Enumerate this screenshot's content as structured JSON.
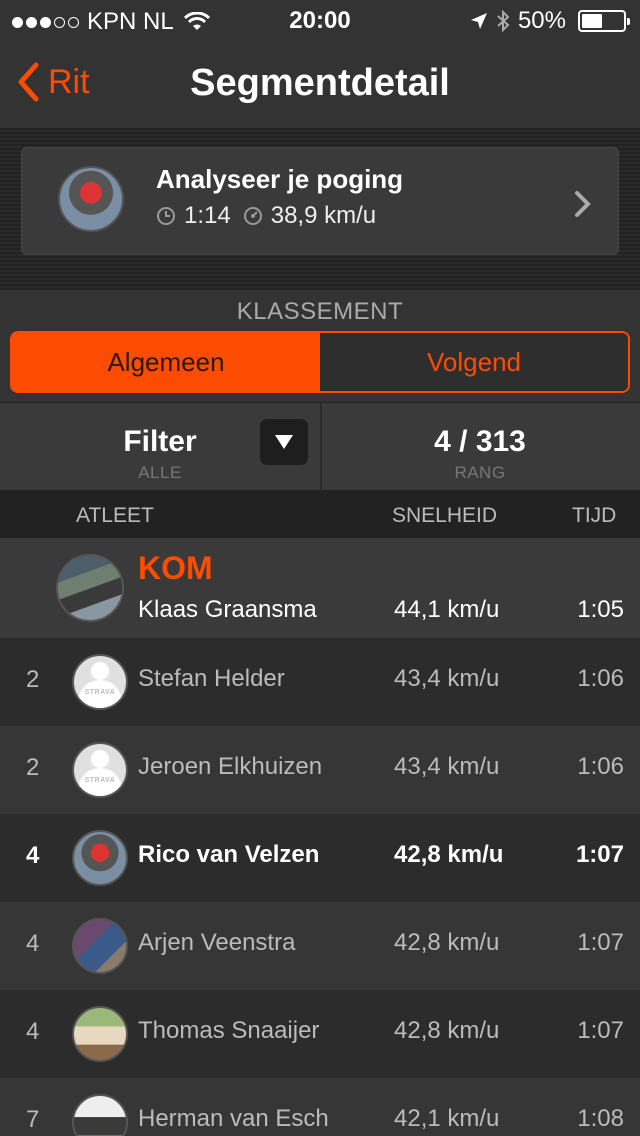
{
  "status_bar": {
    "carrier": "KPN NL",
    "time": "20:00",
    "battery": "50%",
    "signal_dots_filled": 3,
    "signal_dots_total": 5,
    "battery_level": 0.5
  },
  "nav": {
    "back_label": "Rit",
    "title": "Segmentdetail"
  },
  "attempt": {
    "title": "Analyseer je poging",
    "time": "1:14",
    "speed": "38,9 km/u"
  },
  "leaderboard": {
    "section_label": "KLASSEMENT",
    "tabs": [
      "Algemeen",
      "Volgend"
    ],
    "active_tab": "Algemeen",
    "filter_label": "Filter",
    "filter_value": "ALLE",
    "rank_value": "4 / 313",
    "rank_label": "RANG",
    "columns": {
      "athlete": "ATLEET",
      "speed": "SNELHEID",
      "time": "TIJD"
    },
    "kom": {
      "badge": "KOM",
      "name": "Klaas Graansma",
      "speed": "44,1 km/u",
      "time": "1:05"
    },
    "rows": [
      {
        "rank": "2",
        "name": "Stefan Helder",
        "speed": "43,4 km/u",
        "time": "1:06",
        "avatar": "strava-default"
      },
      {
        "rank": "2",
        "name": "Jeroen Elkhuizen",
        "speed": "43,4 km/u",
        "time": "1:06",
        "avatar": "strava-default"
      },
      {
        "rank": "4",
        "name": "Rico van Velzen",
        "speed": "42,8 km/u",
        "time": "1:07",
        "avatar": "photo"
      },
      {
        "rank": "4",
        "name": "Arjen Veenstra",
        "speed": "42,8 km/u",
        "time": "1:07",
        "avatar": "photo"
      },
      {
        "rank": "4",
        "name": "Thomas Snaaijer",
        "speed": "42,8 km/u",
        "time": "1:07",
        "avatar": "photo"
      },
      {
        "rank": "7",
        "name": "Herman van Esch",
        "speed": "42,1 km/u",
        "time": "1:08",
        "avatar": "photo"
      }
    ],
    "strava_placeholder_text": "STRAVA"
  },
  "colors": {
    "accent": "#fc4c02",
    "background": "#2c2c2c"
  }
}
